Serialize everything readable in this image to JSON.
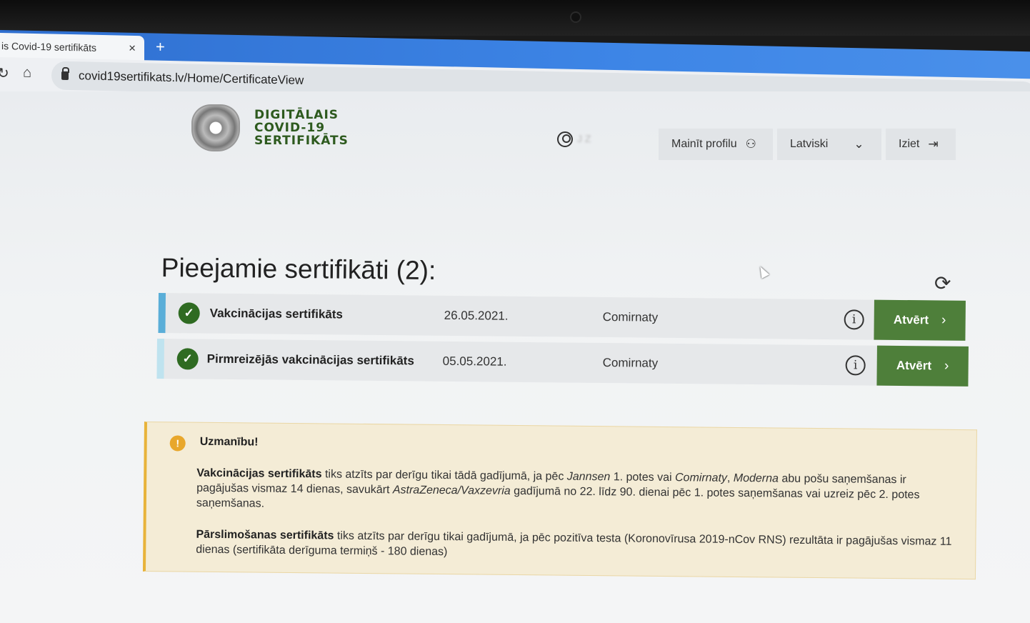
{
  "browser": {
    "tab_title": "is Covid-19 sertifikāts",
    "tab_close": "×",
    "new_tab": "+",
    "url": "covid19sertifikats.lv/Home/CertificateView"
  },
  "header": {
    "logo_lines": [
      "DIGITĀLAIS",
      "COVID-19",
      "SERTIFIKĀTS"
    ],
    "user_name": "J Z",
    "change_profile": "Mainīt profilu",
    "language": "Latviski",
    "logout": "Iziet"
  },
  "main": {
    "title": "Pieejamie sertifikāti (2):",
    "certificates": [
      {
        "name": "Vakcinācijas sertifikāts",
        "date": "26.05.2021.",
        "vaccine": "Comirnaty",
        "button": "Atvērt",
        "stripe_color": "#5aaed8"
      },
      {
        "name": "Pirmreizējās vakcinācijas sertifikāts",
        "date": "05.05.2021.",
        "vaccine": "Comirnaty",
        "button": "Atvērt",
        "stripe_color": "#bfe3ef"
      }
    ]
  },
  "notice": {
    "title": "Uzmanību!",
    "p1_bold": "Vakcinācijas sertifikāts",
    "p1_a": " tiks atzīts par derīgu tikai tādā gadījumā, ja pēc ",
    "p1_i1": "Jannsen",
    "p1_b": " 1. potes vai ",
    "p1_i2": "Comirnaty",
    "p1_c": ", ",
    "p1_i3": "Moderna",
    "p1_d": " abu pošu saņemšanas ir pagājušas vismaz 14 dienas, savukārt ",
    "p1_i4": "AstraZeneca/Vaxzevria",
    "p1_e": " gadījumā no 22. līdz 90. dienai pēc 1. potes saņemšanas vai uzreiz pēc 2. potes saņemšanas.",
    "p2_bold": "Pārslimošanas sertifikāts",
    "p2_text": " tiks atzīts par derīgu tikai gadījumā, ja pēc pozitīva testa (Koronovīrusa 2019-nCov RNS) rezultāta ir pagājušas vismaz 11 dienas (sertifikāta derīguma termiņš - 180 dienas)"
  }
}
